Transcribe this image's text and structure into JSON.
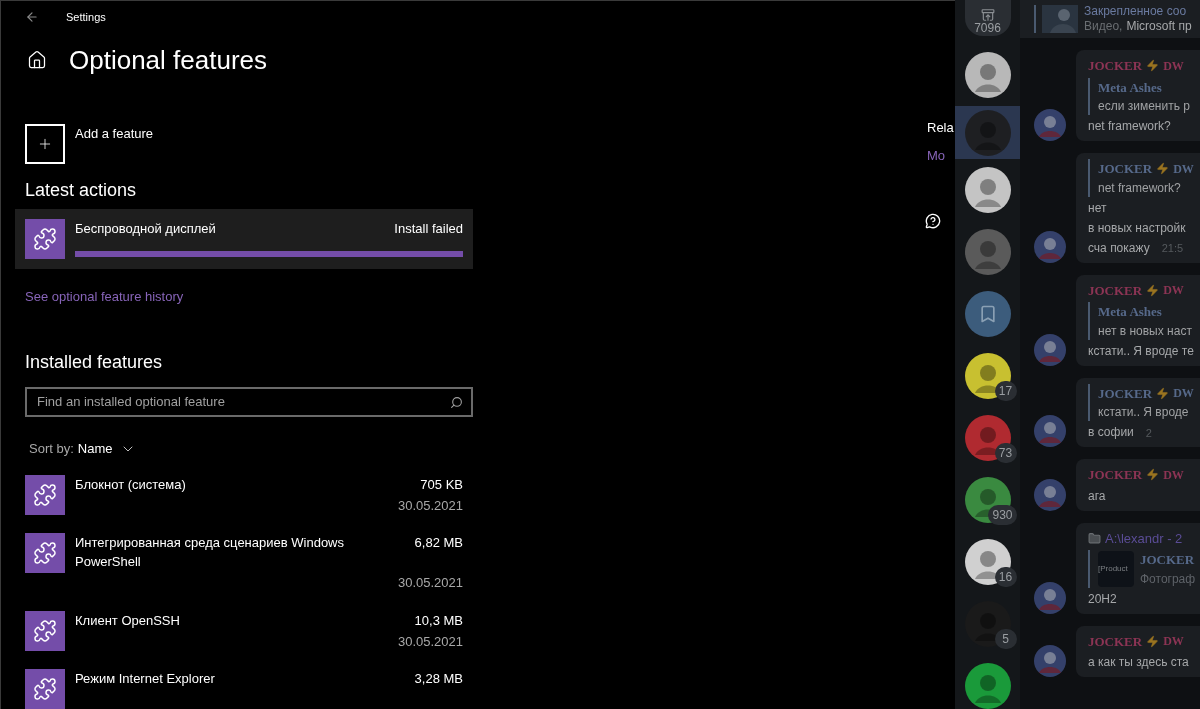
{
  "settings": {
    "title": "Settings",
    "page_title": "Optional features",
    "add_feature": "Add a feature",
    "latest_heading": "Latest actions",
    "latest": [
      {
        "name": "Беспроводной дисплей",
        "status": "Install failed",
        "level": 1
      }
    ],
    "history_link": "See optional feature history",
    "installed_heading": "Installed features",
    "search": {
      "placeholder": "Find an installed optional feature"
    },
    "sort": {
      "label": "Sort by:",
      "value": "Name"
    },
    "features": [
      {
        "name": "Блокнот (система)",
        "size": "705 KB",
        "date": "30.05.2021"
      },
      {
        "name": "Интегрированная среда сценариев Windows PowerShell",
        "size": "6,82 MB",
        "date": "30.05.2021"
      },
      {
        "name": "Клиент OpenSSH",
        "size": "10,3 MB",
        "date": "30.05.2021"
      },
      {
        "name": "Режим Internet Explorer",
        "size": "3,28 MB"
      }
    ],
    "related": {
      "heading": "Rela",
      "link": "Mo"
    }
  },
  "telegram": {
    "pinned": {
      "title": "Закрепленное соо",
      "media": "Видео,",
      "text": "Microsoft пр"
    },
    "chats": [
      {
        "kind": "folder",
        "badge": "7096",
        "selected": false
      },
      {
        "kind": "avatar",
        "color": "#b8b8b8",
        "selected": false
      },
      {
        "kind": "avatar",
        "color": "#1e1f22",
        "selected": true
      },
      {
        "kind": "avatar",
        "color": "#c4c4c4",
        "selected": false
      },
      {
        "kind": "avatar",
        "color": "#5a5a5a",
        "selected": false
      },
      {
        "kind": "saved",
        "selected": false
      },
      {
        "kind": "avatar",
        "color": "#c8c030",
        "badge": "17",
        "selected": false
      },
      {
        "kind": "avatar",
        "color": "#b02a30",
        "badge": "73",
        "selected": false
      },
      {
        "kind": "avatar",
        "color": "#3a8a40",
        "badge": "930",
        "selected": false
      },
      {
        "kind": "avatar",
        "color": "#d0d0d0",
        "badge": "16",
        "selected": false
      },
      {
        "kind": "avatar",
        "color": "#1a1a1a",
        "badge": "5",
        "selected": false
      },
      {
        "kind": "avatar",
        "color": "#1a9a3a",
        "selected": false
      }
    ],
    "messages": [
      {
        "author": "JOCKER",
        "tag": "DW",
        "reply": {
          "author": "Meta Ashes",
          "text": "если зименить р"
        },
        "lines": [
          "net framework?"
        ]
      },
      {
        "reply": {
          "author": "JOCKER",
          "tag": "DW",
          "text": "net framework?"
        },
        "lines": [
          "нет",
          "в новых настройк",
          "сча покажу"
        ],
        "time": "21:5"
      },
      {
        "author": "JOCKER",
        "tag": "DW",
        "reply": {
          "author": "Meta Ashes",
          "text": "нет в новых наст"
        },
        "lines": [
          "кстати.. Я вроде те"
        ]
      },
      {
        "reply": {
          "author": "JOCKER",
          "tag": "DW",
          "text": "кстати.. Я вроде"
        },
        "lines": [
          "в софии"
        ],
        "time": "2"
      },
      {
        "author": "JOCKER",
        "tag": "DW",
        "lines": [
          "ага"
        ]
      },
      {
        "forward": "A:\\lexandr - 2",
        "reply": {
          "thumb": "[Product",
          "author": "JOCKER",
          "text": "Фотограф"
        },
        "lines": [
          "20H2"
        ]
      },
      {
        "author": "JOCKER",
        "tag": "DW",
        "lines": [
          "а как ты здесь ста"
        ]
      }
    ]
  }
}
